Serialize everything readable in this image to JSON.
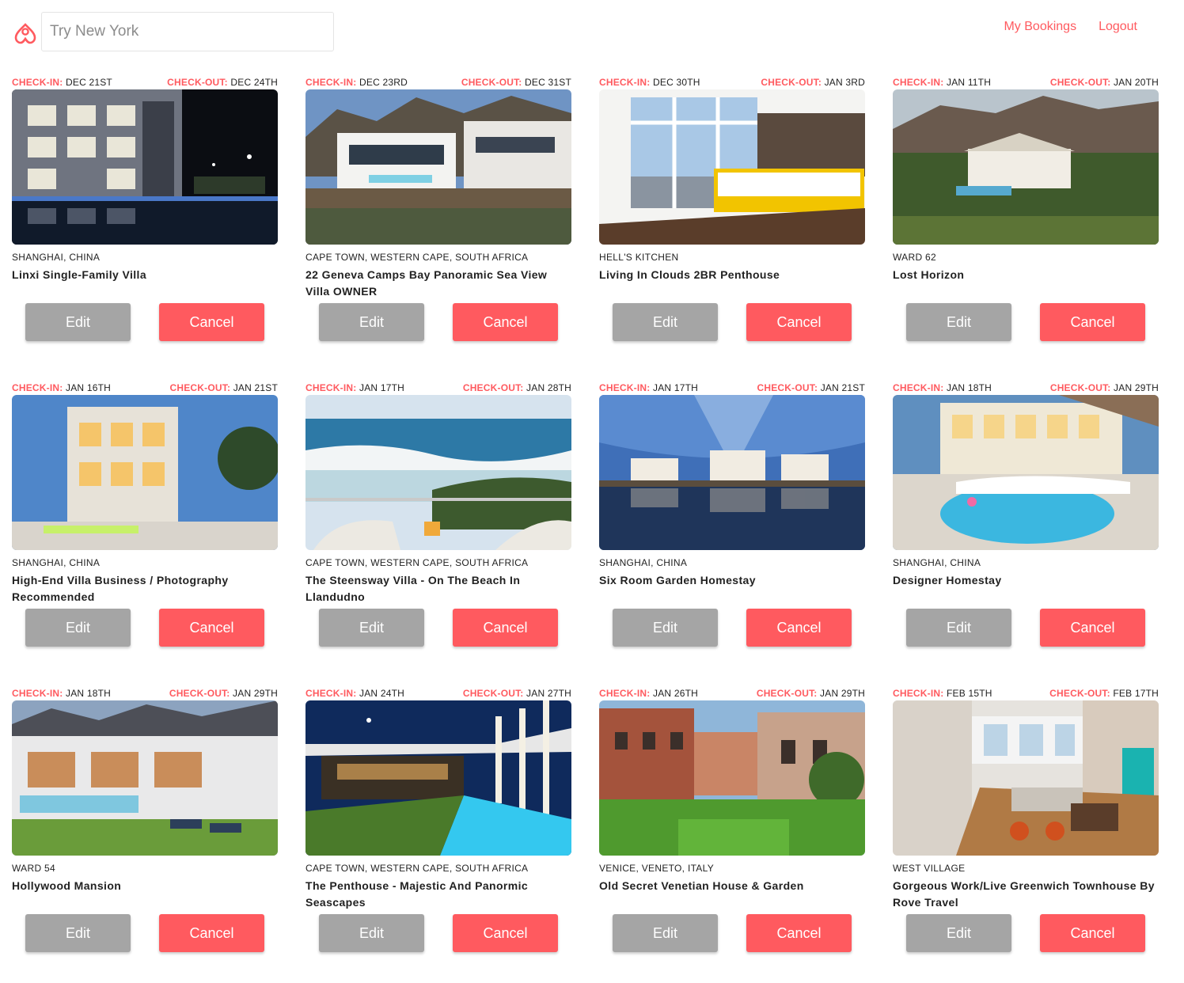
{
  "header": {
    "search_placeholder": "Try New York",
    "nav": {
      "my_bookings": "My Bookings",
      "logout": "Logout"
    }
  },
  "labels": {
    "check_in": "CHECK-IN:",
    "check_out": "CHECK-OUT:",
    "edit": "Edit",
    "cancel": "Cancel"
  },
  "colors": {
    "accent": "#ff5a5f",
    "edit_button": "#a5a5a5"
  },
  "bookings": [
    {
      "check_in": "DEC 21ST",
      "check_out": "DEC 24TH",
      "location": "SHANGHAI, CHINA",
      "title": "Linxi Single-Family Villa"
    },
    {
      "check_in": "DEC 23RD",
      "check_out": "DEC 31ST",
      "location": "CAPE TOWN, WESTERN CAPE, SOUTH AFRICA",
      "title": "22 Geneva Camps Bay Panoramic Sea View Villa OWNER"
    },
    {
      "check_in": "DEC 30TH",
      "check_out": "JAN 3RD",
      "location": "HELL'S KITCHEN",
      "title": "Living In Clouds 2BR Penthouse"
    },
    {
      "check_in": "JAN 11TH",
      "check_out": "JAN 20TH",
      "location": "WARD 62",
      "title": "Lost Horizon"
    },
    {
      "check_in": "JAN 16TH",
      "check_out": "JAN 21ST",
      "location": "SHANGHAI, CHINA",
      "title": "High-End Villa Business / Photography Recommended"
    },
    {
      "check_in": "JAN 17TH",
      "check_out": "JAN 28TH",
      "location": "CAPE TOWN, WESTERN CAPE, SOUTH AFRICA",
      "title": "The Steensway Villa - On The Beach In Llandudno"
    },
    {
      "check_in": "JAN 17TH",
      "check_out": "JAN 21ST",
      "location": "SHANGHAI, CHINA",
      "title": "Six Room Garden Homestay"
    },
    {
      "check_in": "JAN 18TH",
      "check_out": "JAN 29TH",
      "location": "SHANGHAI, CHINA",
      "title": "Designer Homestay"
    },
    {
      "check_in": "JAN 18TH",
      "check_out": "JAN 29TH",
      "location": "WARD 54",
      "title": "Hollywood Mansion"
    },
    {
      "check_in": "JAN 24TH",
      "check_out": "JAN 27TH",
      "location": "CAPE TOWN, WESTERN CAPE, SOUTH AFRICA",
      "title": "The Penthouse - Majestic And Panormic Seascapes"
    },
    {
      "check_in": "JAN 26TH",
      "check_out": "JAN 29TH",
      "location": "VENICE, VENETO, ITALY",
      "title": "Old Secret Venetian House & Garden"
    },
    {
      "check_in": "FEB 15TH",
      "check_out": "FEB 17TH",
      "location": "WEST VILLAGE",
      "title": "Gorgeous Work/Live Greenwich Townhouse By Rove Travel"
    }
  ]
}
